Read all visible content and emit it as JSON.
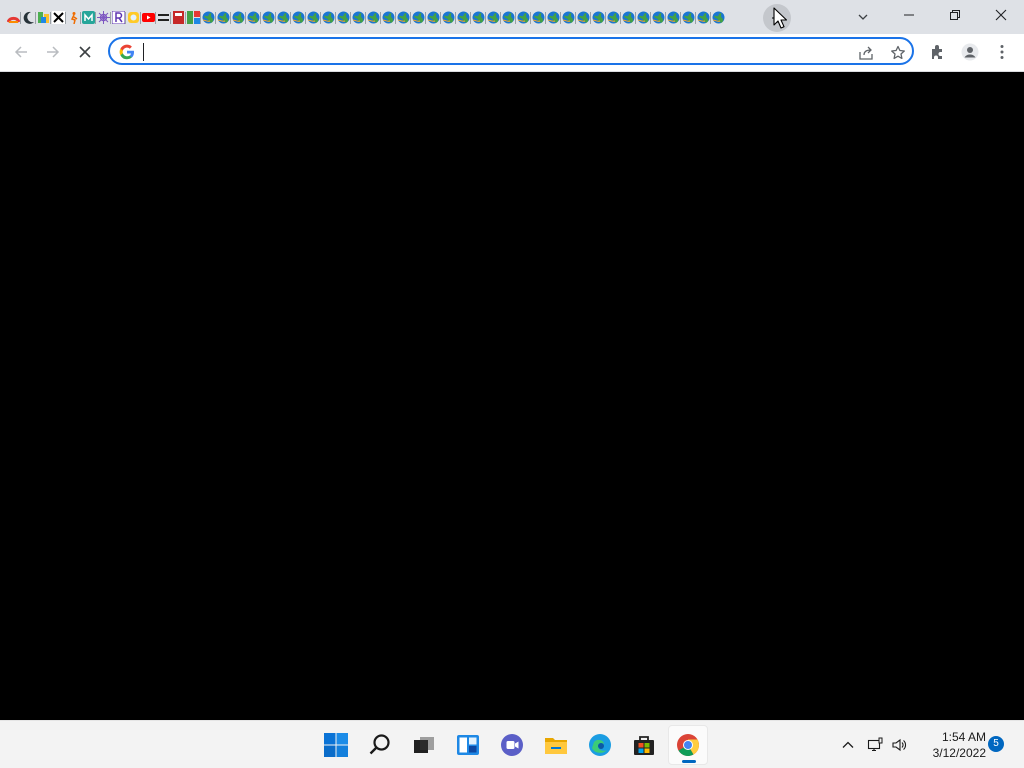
{
  "colors": {
    "titlebar_bg": "#dee1e6",
    "toolbar_bg": "#ffffff",
    "omnibox_focus": "#1a73e8",
    "viewport_bg": "#000000",
    "taskbar_bg": "#f3f3f3",
    "accent": "#0067c0"
  },
  "browser": {
    "tabs": [
      {
        "icon": "red-arc-icon"
      },
      {
        "icon": "moon-icon"
      },
      {
        "icon": "green-leaf-icon"
      },
      {
        "icon": "x-logo-icon"
      },
      {
        "icon": "hiker-icon"
      },
      {
        "icon": "m-logo-icon"
      },
      {
        "icon": "gear-snowflake-icon"
      },
      {
        "icon": "r-logo-icon"
      },
      {
        "icon": "gem-icon"
      },
      {
        "icon": "youtube-icon"
      },
      {
        "icon": "equals-icon"
      },
      {
        "icon": "book-icon"
      },
      {
        "icon": "tile-icon"
      },
      {
        "icon": "globe-icon"
      },
      {
        "icon": "globe-icon"
      },
      {
        "icon": "globe-icon"
      },
      {
        "icon": "globe-icon"
      },
      {
        "icon": "globe-icon"
      },
      {
        "icon": "globe-icon"
      },
      {
        "icon": "globe-icon"
      },
      {
        "icon": "globe-icon"
      },
      {
        "icon": "globe-icon"
      },
      {
        "icon": "globe-icon"
      },
      {
        "icon": "globe-icon"
      },
      {
        "icon": "globe-icon"
      },
      {
        "icon": "globe-icon"
      },
      {
        "icon": "globe-icon"
      },
      {
        "icon": "globe-icon"
      },
      {
        "icon": "globe-icon"
      },
      {
        "icon": "globe-icon"
      },
      {
        "icon": "globe-icon"
      },
      {
        "icon": "globe-icon"
      },
      {
        "icon": "globe-icon"
      },
      {
        "icon": "globe-icon"
      },
      {
        "icon": "globe-icon"
      },
      {
        "icon": "globe-icon"
      },
      {
        "icon": "globe-icon"
      },
      {
        "icon": "globe-icon"
      },
      {
        "icon": "globe-icon"
      },
      {
        "icon": "globe-icon"
      },
      {
        "icon": "globe-icon"
      },
      {
        "icon": "globe-icon"
      },
      {
        "icon": "globe-icon"
      },
      {
        "icon": "globe-icon"
      },
      {
        "icon": "globe-icon"
      },
      {
        "icon": "globe-icon"
      },
      {
        "icon": "globe-icon"
      },
      {
        "icon": "globe-icon"
      }
    ],
    "omnibox": {
      "value": "",
      "placeholder": ""
    },
    "toolbar_icons": [
      "back-icon",
      "forward-icon",
      "stop-loading-icon",
      "google-icon",
      "share-icon",
      "bookmark-star-icon",
      "extensions-icon",
      "profile-icon",
      "menu-icon"
    ]
  },
  "taskbar": {
    "apps": [
      "windows-start-icon",
      "search-icon",
      "task-view-icon",
      "widgets-icon",
      "teams-chat-icon",
      "file-explorer-icon",
      "edge-icon",
      "store-icon",
      "chrome-icon"
    ],
    "tray": {
      "time": "1:54 AM",
      "date": "3/12/2022",
      "notification_count": "5"
    }
  }
}
